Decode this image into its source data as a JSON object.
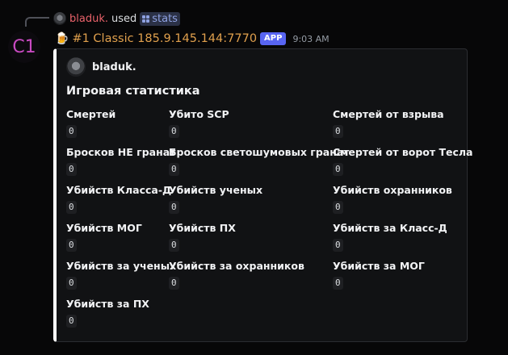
{
  "reference": {
    "user": "bladuk.",
    "used": "used",
    "command": "stats"
  },
  "bot": {
    "avatar_text": "C1",
    "name": "#1 Classic 185.9.145.144:7770",
    "tag": "APP",
    "timestamp": "9:03 AM"
  },
  "embed": {
    "author": "bladuk.",
    "title": "Игровая статистика",
    "fields": [
      {
        "name": "Смертей",
        "value": "0"
      },
      {
        "name": "Убито SCP",
        "value": "0"
      },
      {
        "name": "Смертей от взрыва",
        "value": "0"
      },
      {
        "name": "Бросков НЕ гранат",
        "value": "0"
      },
      {
        "name": "Бросков светошумовых гранат",
        "value": "0"
      },
      {
        "name": "Смертей от ворот Тесла",
        "value": "0"
      },
      {
        "name": "Убийств Класса-Д",
        "value": "0"
      },
      {
        "name": "Убийств ученых",
        "value": "0"
      },
      {
        "name": "Убийств охранников",
        "value": "0"
      },
      {
        "name": "Убийств МОГ",
        "value": "0"
      },
      {
        "name": "Убийств ПХ",
        "value": "0"
      },
      {
        "name": "Убийств за Класс-Д",
        "value": "0"
      },
      {
        "name": "Убийств за ученых",
        "value": "0"
      },
      {
        "name": "Убийств за охранников",
        "value": "0"
      },
      {
        "name": "Убийств за МОГ",
        "value": "0"
      },
      {
        "name": "Убийств за ПХ",
        "value": "0"
      }
    ]
  },
  "colors": {
    "background": "#070708",
    "embed_bg": "#111214",
    "embed_accent": "#ffffff",
    "bot_name": "#e0a04d",
    "reference_user": "#e8626a",
    "app_tag": "#5865f2"
  }
}
